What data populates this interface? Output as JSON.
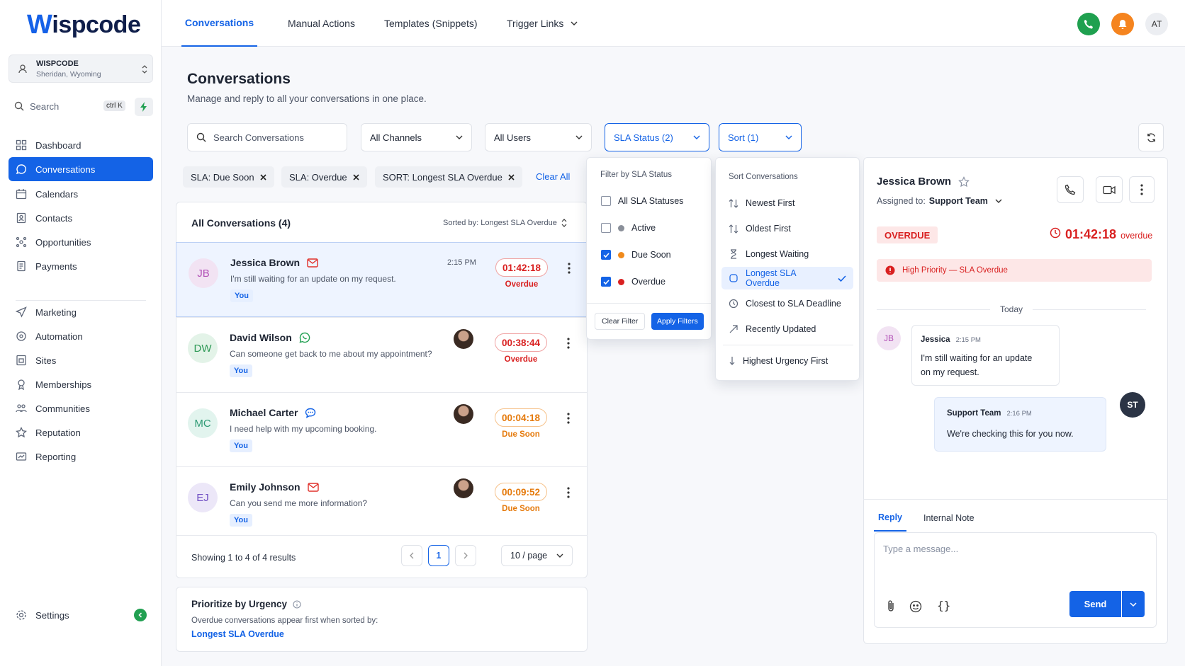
{
  "brand": {
    "logo_w": "W",
    "logo_rest": "ispcode",
    "location_name": "WISPCODE",
    "location_sub": "Sheridan, Wyoming"
  },
  "sidebar": {
    "search": "Search",
    "shortcut": "ctrl K",
    "items": [
      {
        "label": "Dashboard",
        "icon": "grid-icon"
      },
      {
        "label": "Conversations",
        "icon": "chat-icon",
        "active": true
      },
      {
        "label": "Calendars",
        "icon": "calendar-icon"
      },
      {
        "label": "Contacts",
        "icon": "contacts-icon"
      },
      {
        "label": "Opportunities",
        "icon": "opportunities-icon"
      },
      {
        "label": "Payments",
        "icon": "payments-icon"
      },
      {
        "label": "Marketing",
        "icon": "send-icon"
      },
      {
        "label": "Automation",
        "icon": "automation-icon"
      },
      {
        "label": "Sites",
        "icon": "sites-icon"
      },
      {
        "label": "Memberships",
        "icon": "memberships-icon"
      },
      {
        "label": "Communities",
        "icon": "communities-icon"
      },
      {
        "label": "Reputation",
        "icon": "star-icon"
      },
      {
        "label": "Reporting",
        "icon": "reporting-icon"
      }
    ],
    "settings": "Settings"
  },
  "topnav": {
    "tabs": [
      "Conversations",
      "Manual Actions",
      "Templates (Snippets)",
      "Trigger Links"
    ],
    "avatar": "AT",
    "colors": {
      "phone": "#1fa04f",
      "bell": "#f5841f"
    }
  },
  "page": {
    "title": "Conversations",
    "subtitle": "Manage and reply to all your conversations in one place."
  },
  "filters": {
    "search_placeholder": "Search Conversations",
    "channels": "All Channels",
    "users": "All Users",
    "sla": "SLA Status (2)",
    "sort": "Sort (1)"
  },
  "chips": [
    "SLA: Due Soon",
    "SLA: Overdue",
    "SORT: Longest SLA Overdue"
  ],
  "clear_all": "Clear All",
  "list": {
    "header": "All Conversations (4)",
    "sorted_by": "Sorted by: Longest SLA Overdue",
    "rows": [
      {
        "initials": "JB",
        "name": "Jessica Brown",
        "channel": "email-icon",
        "preview": "I'm still waiting for an update on my request.",
        "tag": "You",
        "time": "2:15 PM",
        "timer": "01:42:18",
        "status": "Overdue"
      },
      {
        "initials": "DW",
        "name": "David Wilson",
        "channel": "whatsapp-icon",
        "preview": "Can someone get back to me about my appointment?",
        "tag": "You",
        "time": "",
        "timer": "00:38:44",
        "status": "Overdue"
      },
      {
        "initials": "MC",
        "name": "Michael Carter",
        "channel": "chat-icon",
        "preview": "I need help with my upcoming booking.",
        "tag": "You",
        "time": "",
        "timer": "00:04:18",
        "status": "Due Soon"
      },
      {
        "initials": "EJ",
        "name": "Emily Johnson",
        "channel": "email-icon",
        "preview": "Can you send me more information?",
        "tag": "You",
        "time": "",
        "timer": "00:09:52",
        "status": "Due Soon"
      }
    ],
    "showing": "Showing 1 to 4 of 4 results",
    "page": "1",
    "per_page": "10 / page"
  },
  "urgency": {
    "title": "Prioritize by Urgency",
    "text": "Overdue conversations appear first when sorted by:",
    "link": "Longest SLA Overdue"
  },
  "sla_menu": {
    "title": "Filter by SLA Status",
    "options": [
      {
        "label": "All SLA Statuses",
        "checked": false,
        "color": ""
      },
      {
        "label": "Active",
        "checked": false,
        "color": "#8a8f99"
      },
      {
        "label": "Due Soon",
        "checked": true,
        "color": "#f08a1c"
      },
      {
        "label": "Overdue",
        "checked": true,
        "color": "#d92020"
      }
    ],
    "clear": "Clear Filter",
    "apply": "Apply Filters"
  },
  "sort_menu": {
    "title": "Sort Conversations",
    "options": [
      "Newest First",
      "Oldest First",
      "Longest Waiting",
      "Longest SLA Overdue",
      "Closest to SLA Deadline",
      "Recently Updated",
      "Highest Urgency First"
    ],
    "selected": "Longest SLA Overdue"
  },
  "detail": {
    "name": "Jessica Brown",
    "assigned_label": "Assigned to:",
    "assigned_team": "Support Team",
    "badge": "OVERDUE",
    "timer": "01:42:18",
    "timer_suffix": "overdue",
    "alert": "High Priority — SLA Overdue",
    "day": "Today",
    "messages": [
      {
        "initials": "JB",
        "author": "Jessica",
        "time": "2:15 PM",
        "text_1": "I'm still waiting for an update",
        "text_2": "on my request."
      },
      {
        "initials": "ST",
        "author": "Support Team",
        "time": "2:16 PM",
        "text": "We're checking this for you now."
      }
    ],
    "tabs": [
      "Reply",
      "Internal Note"
    ],
    "placeholder": "Type a message...",
    "send": "Send"
  }
}
